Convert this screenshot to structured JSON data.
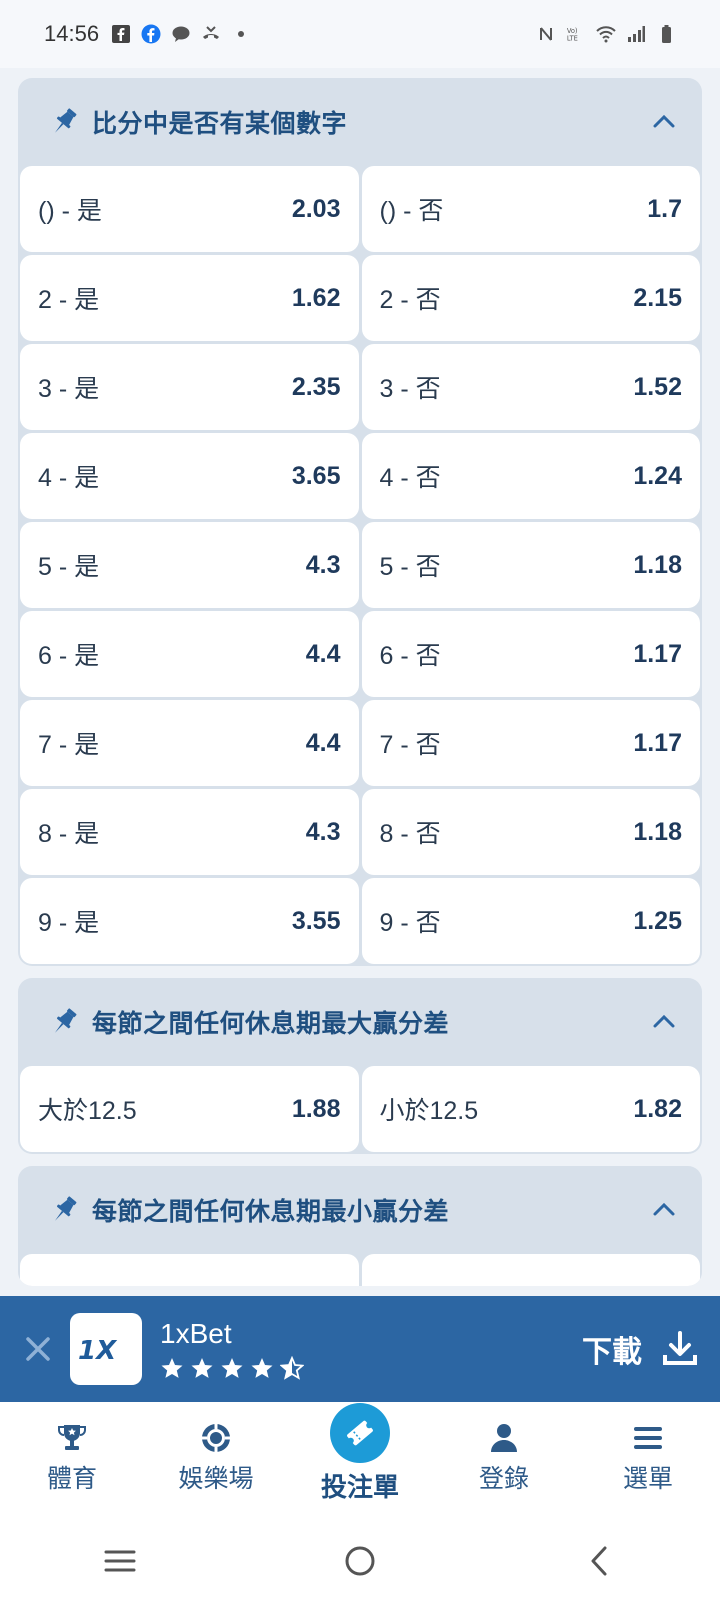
{
  "status_bar": {
    "time": "14:56"
  },
  "markets": [
    {
      "title": "比分中是否有某個數字",
      "rows": [
        [
          {
            "label": "() - 是",
            "odd": "2.03"
          },
          {
            "label": "() - 否",
            "odd": "1.7"
          }
        ],
        [
          {
            "label": "2 - 是",
            "odd": "1.62"
          },
          {
            "label": "2 - 否",
            "odd": "2.15"
          }
        ],
        [
          {
            "label": "3 - 是",
            "odd": "2.35"
          },
          {
            "label": "3 - 否",
            "odd": "1.52"
          }
        ],
        [
          {
            "label": "4 - 是",
            "odd": "3.65"
          },
          {
            "label": "4 - 否",
            "odd": "1.24"
          }
        ],
        [
          {
            "label": "5 - 是",
            "odd": "4.3"
          },
          {
            "label": "5 - 否",
            "odd": "1.18"
          }
        ],
        [
          {
            "label": "6 - 是",
            "odd": "4.4"
          },
          {
            "label": "6 - 否",
            "odd": "1.17"
          }
        ],
        [
          {
            "label": "7 - 是",
            "odd": "4.4"
          },
          {
            "label": "7 - 否",
            "odd": "1.17"
          }
        ],
        [
          {
            "label": "8 - 是",
            "odd": "4.3"
          },
          {
            "label": "8 - 否",
            "odd": "1.18"
          }
        ],
        [
          {
            "label": "9 - 是",
            "odd": "3.55"
          },
          {
            "label": "9 - 否",
            "odd": "1.25"
          }
        ]
      ]
    },
    {
      "title": "每節之間任何休息期最大贏分差",
      "rows": [
        [
          {
            "label": "大於12.5",
            "odd": "1.88"
          },
          {
            "label": "小於12.5",
            "odd": "1.82"
          }
        ]
      ]
    },
    {
      "title": "每節之間任何休息期最小贏分差",
      "rows": []
    }
  ],
  "banner": {
    "app_name": "1xBet",
    "rating": 4.5,
    "download_label": "下載"
  },
  "bottom_nav": {
    "sports": "體育",
    "casino": "娛樂場",
    "betslip": "投注單",
    "login": "登錄",
    "menu": "選單"
  },
  "colors": {
    "accent": "#2c66a3",
    "betslip_circle": "#1d9bd7",
    "header_bg": "#d7e0ea"
  }
}
